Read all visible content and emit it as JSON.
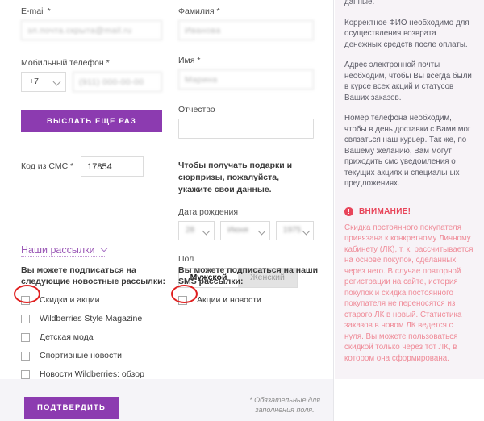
{
  "form": {
    "left": {
      "email_label": "E-mail *",
      "email_value": "эл.почта.скрыта@mail.ru",
      "phone_label": "Мобильный телефон *",
      "phone_code": "+7",
      "phone_value": "(911) 000-00-00",
      "resend_button": "ВЫСЛАТЬ ЕЩЕ РАЗ",
      "sms_code_label": "Код из СМС *",
      "sms_code_value": "17854"
    },
    "right": {
      "surname_label": "Фамилия *",
      "surname_value": "Иванова",
      "firstname_label": "Имя *",
      "firstname_value": "Марина",
      "patronymic_label": "Отчество",
      "patronymic_value": "",
      "gift_note": "Чтобы получать подарки и сюрпризы, пожалуйста, укажите свои данные.",
      "dob_label": "Дата рождения",
      "dob_day": "28",
      "dob_month": "Июня",
      "dob_year": "1975",
      "gender_label": "Пол",
      "gender_male": "Мужской",
      "gender_female": "Женский",
      "gender_selected": "Мужской"
    }
  },
  "newsletters": {
    "header": "Наши рассылки",
    "email_intro": "Вы можете подписаться на следующие новостные рассылки:",
    "email_items": [
      "Скидки и акции",
      "Wildberries Style Magazine",
      "Детская мода",
      "Спортивные новости",
      "Новости Wildberries: обзор последних обновлений на сайте не только"
    ],
    "sms_intro": "Вы можете подписаться на наши SMS рассылки:",
    "sms_items": [
      "Акции и новости"
    ]
  },
  "footer": {
    "confirm_button": "ПОДТВЕРДИТЬ",
    "required_note": "* Обязательные для заполнения поля."
  },
  "sidebar": {
    "paragraphs": [
      "данные.",
      "Корректное ФИО необходимо для осуществления возврата денежных средств после оплаты.",
      "Адрес электронной почты необходим, чтобы Вы всегда были в курсе всех акций и статусов Ваших заказов.",
      "Номер телефона необходим, чтобы в день доставки с Вами мог связаться наш курьер. Так же, по Вашему желанию, Вам могут приходить смс уведомления о текущих акциях и специальных предложениях."
    ],
    "warning_mark": "!",
    "warning_title": "ВНИМАНИЕ!",
    "warning_body": "Скидка постоянного покупателя привязана к конкретному Личному кабинету (ЛК), т. к. рассчитывается на основе покупок, сделанных через него. В случае повторной регистрации на сайте, история покупок и скидка постоянного покупателя не переносятся из старого ЛК в новый. Статистика заказов в новом ЛК ведется с нуля. Вы можете пользоваться скидкой только через тот ЛК, в котором она сформирована."
  },
  "colors": {
    "accent_purple": "#8c3bb0",
    "warning_red": "#e8455a",
    "annotation_red": "#e02020",
    "sidebar_bg": "#f7f3f7",
    "footer_bg": "#f5f4f8"
  }
}
